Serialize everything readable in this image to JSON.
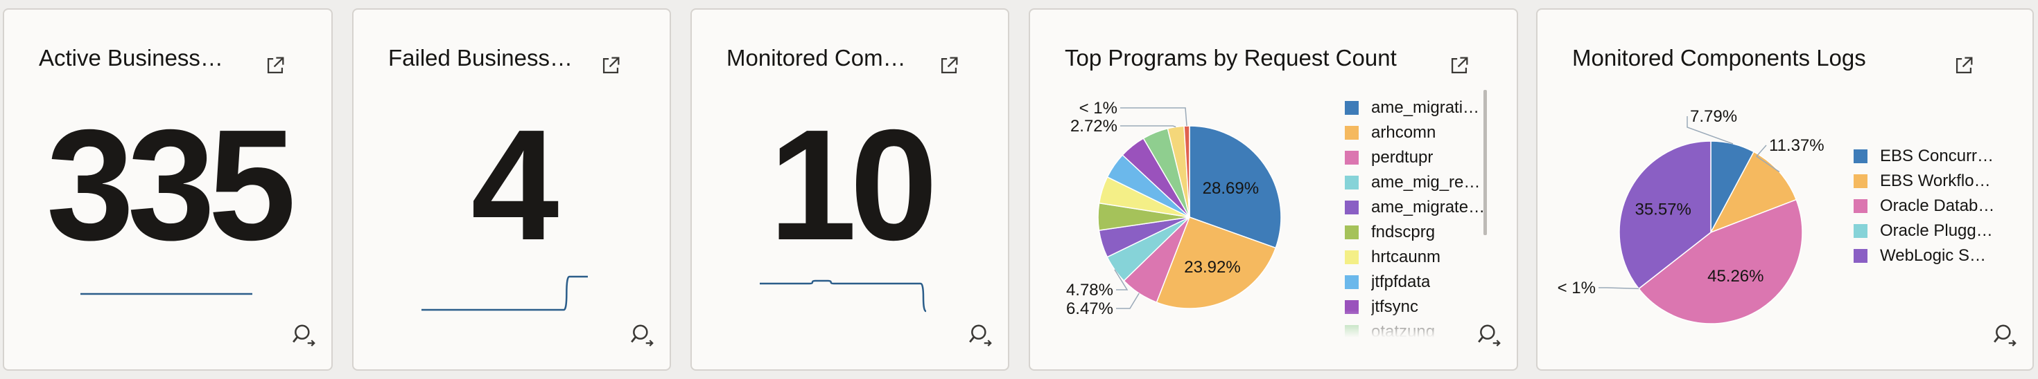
{
  "tiles": [
    {
      "title": "Active Business…",
      "value": "335"
    },
    {
      "title": "Failed Business…",
      "value": "4"
    },
    {
      "title": "Monitored Com…",
      "value": "10"
    },
    {
      "title": "Top Programs by Request Count"
    },
    {
      "title": "Monitored Components Logs"
    }
  ],
  "icons": {
    "open": "open-in-new-window-icon",
    "search": "search-drill-down-icon"
  },
  "colors": {
    "blue": "#3e7cb8",
    "orange": "#f5b95f",
    "pink": "#db76b0",
    "teal": "#86d3d8",
    "purple": "#8a5fc4",
    "olive": "#a5c25a",
    "yellow": "#f4ef87",
    "lightblue": "#6bb8eb",
    "violet": "#9a52bc",
    "green": "#8fce8f",
    "red": "#e0614f",
    "spark": "#2b5d8a"
  },
  "chart_data": [
    {
      "type": "line",
      "title": "Active Business…",
      "x": [
        0,
        1,
        2,
        3,
        4,
        5,
        6,
        7,
        8,
        9
      ],
      "series": [
        {
          "values": [
            335,
            335,
            335,
            335,
            335,
            335,
            335,
            335,
            335,
            335
          ]
        }
      ]
    },
    {
      "type": "line",
      "title": "Failed Business…",
      "x": [
        0,
        1,
        2,
        3,
        4,
        5,
        6,
        7,
        8,
        9
      ],
      "series": [
        {
          "values": [
            0,
            0,
            0,
            0,
            0,
            0,
            0,
            0,
            4,
            4
          ]
        }
      ]
    },
    {
      "type": "line",
      "title": "Monitored Com…",
      "x": [
        0,
        1,
        2,
        3,
        4,
        5,
        6,
        7,
        8,
        9
      ],
      "series": [
        {
          "values": [
            10,
            10,
            10,
            11,
            10,
            10,
            10,
            10,
            10,
            0
          ]
        }
      ]
    },
    {
      "type": "pie",
      "title": "Top Programs by Request Count",
      "legend_position": "right",
      "slice_labels": [
        {
          "text": "28.69%",
          "slice": 0
        },
        {
          "text": "23.92%",
          "slice": 1
        },
        {
          "text": "6.47%",
          "slice": 2
        },
        {
          "text": "4.78%",
          "slice": 3
        },
        {
          "text": "2.72%",
          "slice": 10
        },
        {
          "text": "< 1%",
          "slice": 11
        }
      ],
      "slices": [
        {
          "name": "ame_migrati…",
          "value": 28.69,
          "color": "#3e7cb8"
        },
        {
          "name": "arhcomn",
          "value": 23.92,
          "color": "#f5b95f"
        },
        {
          "name": "perdtupr",
          "value": 6.47,
          "color": "#db76b0"
        },
        {
          "name": "ame_mig_re…",
          "value": 4.78,
          "color": "#86d3d8"
        },
        {
          "name": "ame_migrate…",
          "value": 4.6,
          "color": "#8a5fc4"
        },
        {
          "name": "fndscprg",
          "value": 4.5,
          "color": "#a5c25a"
        },
        {
          "name": "hrtcaunm",
          "value": 4.5,
          "color": "#f4ef87"
        },
        {
          "name": "jtfpfdata",
          "value": 4.4,
          "color": "#6bb8eb"
        },
        {
          "name": "jtfsync",
          "value": 4.4,
          "color": "#9a52bc"
        },
        {
          "name": "otatzung",
          "value": 4.3,
          "color": "#8fce8f"
        },
        {
          "name": "",
          "value": 2.72,
          "color": "#f4d77a"
        },
        {
          "name": "",
          "value": 0.9,
          "color": "#e0614f"
        }
      ]
    },
    {
      "type": "pie",
      "title": "Monitored Components Logs",
      "legend_position": "right",
      "slice_labels": [
        {
          "text": "7.79%",
          "slice": 0
        },
        {
          "text": "11.37%",
          "slice": 1
        },
        {
          "text": "45.26%",
          "slice": 2
        },
        {
          "text": "< 1%",
          "slice": 3
        },
        {
          "text": "35.57%",
          "slice": 4
        }
      ],
      "slices": [
        {
          "name": "EBS Concurr…",
          "value": 7.79,
          "color": "#3e7cb8"
        },
        {
          "name": "EBS Workflo…",
          "value": 11.37,
          "color": "#f5b95f"
        },
        {
          "name": "Oracle Datab…",
          "value": 45.26,
          "color": "#db76b0"
        },
        {
          "name": "Oracle Plugg…",
          "value": 0.01,
          "color": "#86d3d8"
        },
        {
          "name": "WebLogic S…",
          "value": 35.57,
          "color": "#8a5fc4"
        }
      ]
    }
  ]
}
